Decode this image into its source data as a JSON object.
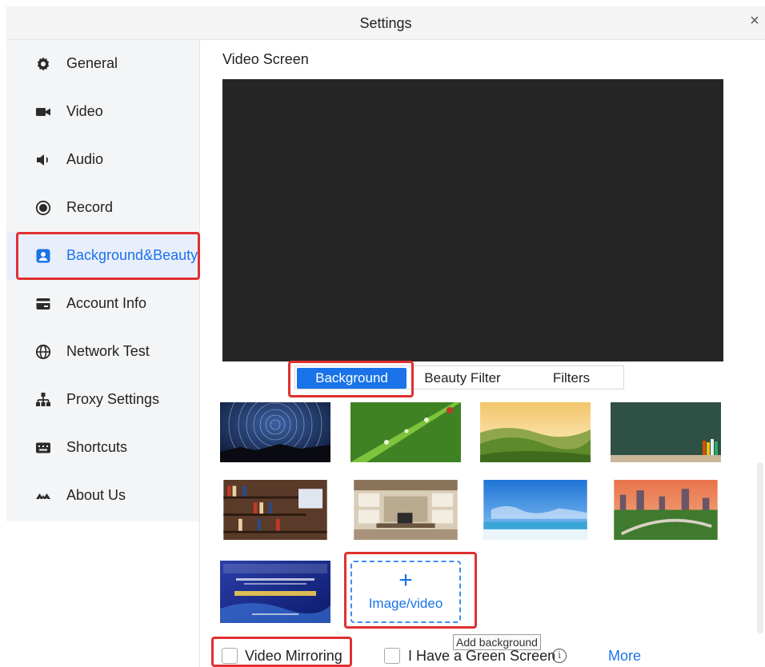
{
  "window": {
    "title": "Settings",
    "close_glyph": "×"
  },
  "sidebar": {
    "items": [
      {
        "label": "General",
        "icon": "gear-icon",
        "active": false
      },
      {
        "label": "Video",
        "icon": "video-camera-icon",
        "active": false
      },
      {
        "label": "Audio",
        "icon": "speaker-icon",
        "active": false
      },
      {
        "label": "Record",
        "icon": "record-icon",
        "active": false
      },
      {
        "label": "Background&Beauty",
        "icon": "portrait-icon",
        "active": true
      },
      {
        "label": "Account Info",
        "icon": "card-icon",
        "active": false
      },
      {
        "label": "Network Test",
        "icon": "globe-icon",
        "active": false
      },
      {
        "label": "Proxy Settings",
        "icon": "network-tree-icon",
        "active": false
      },
      {
        "label": "Shortcuts",
        "icon": "keyboard-icon",
        "active": false
      },
      {
        "label": "About Us",
        "icon": "logo-icon",
        "active": false
      }
    ]
  },
  "main": {
    "section_title": "Video Screen",
    "tabs": [
      {
        "label": "Background",
        "active": true
      },
      {
        "label": "Beauty Filter",
        "active": false
      },
      {
        "label": "Filters",
        "active": false
      }
    ],
    "backgrounds": [
      {
        "name": "star-trails"
      },
      {
        "name": "leaf-droplets"
      },
      {
        "name": "green-hills"
      },
      {
        "name": "chalkboard"
      },
      {
        "name": "bookshelf-office"
      },
      {
        "name": "home-study"
      },
      {
        "name": "beach-sky"
      },
      {
        "name": "city-park-sunset"
      },
      {
        "name": "conference-banner"
      }
    ],
    "add_background": {
      "plus": "+",
      "label": "Image/video",
      "tooltip": "Add background"
    },
    "options": {
      "mirroring_label": "Video Mirroring",
      "green_screen_label": "I Have a Green Screen",
      "info_glyph": "i",
      "more_label": "More"
    }
  },
  "colors": {
    "accent": "#1a73e8",
    "highlight": "#e03030",
    "sidebar_bg": "#f4f5f7",
    "video_bg": "#262626"
  }
}
